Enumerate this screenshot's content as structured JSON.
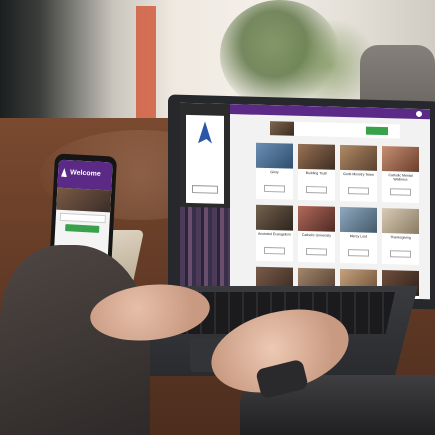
{
  "phone": {
    "title": "Welcome"
  },
  "laptop": {
    "church_tiles": [
      {
        "label": "Glory"
      },
      {
        "label": "Building Truth"
      },
      {
        "label": "Gods Ministry Team"
      },
      {
        "label": "Catholic Mental Wellness"
      },
      {
        "label": "Anointed Evangelism"
      },
      {
        "label": "Catholic University"
      },
      {
        "label": "Mercy Lord"
      },
      {
        "label": "Thanksgiving"
      }
    ]
  },
  "colors": {
    "accent_purple": "#5a2a86",
    "action_green": "#3aa14b"
  }
}
